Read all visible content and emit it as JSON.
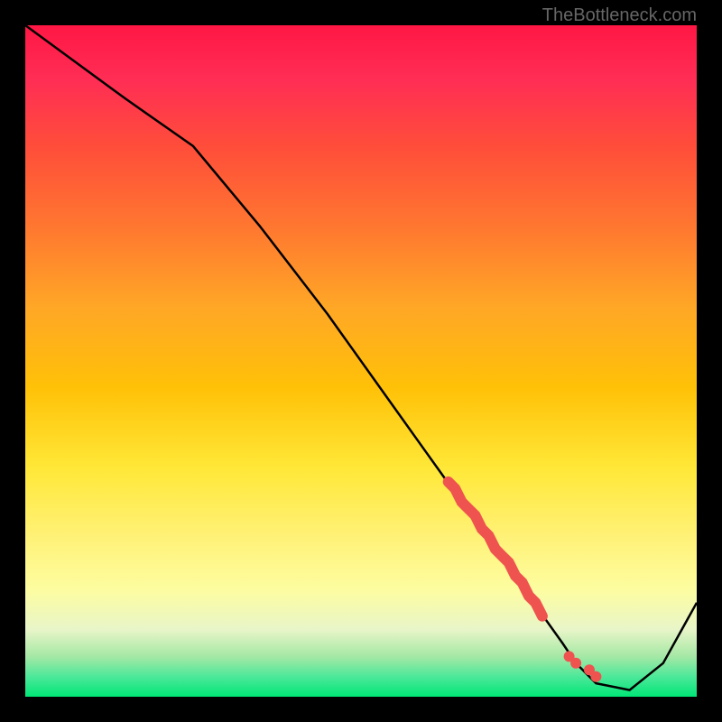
{
  "watermark": "TheBottleneck.com",
  "chart_data": {
    "type": "line",
    "title": "",
    "xlabel": "",
    "ylabel": "",
    "xlim": [
      0,
      100
    ],
    "ylim": [
      0,
      100
    ],
    "series": [
      {
        "name": "bottleneck-curve",
        "x": [
          0,
          15,
          25,
          35,
          45,
          55,
          60,
          65,
          70,
          75,
          80,
          82,
          85,
          90,
          95,
          100
        ],
        "values": [
          100,
          89,
          82,
          70,
          57,
          43,
          36,
          29,
          22,
          15,
          8,
          5,
          2,
          1,
          5,
          14
        ]
      }
    ],
    "markers": {
      "name": "highlight-segment",
      "color": "#ef5350",
      "points": [
        {
          "x": 63,
          "y": 32
        },
        {
          "x": 64,
          "y": 31
        },
        {
          "x": 65,
          "y": 29
        },
        {
          "x": 66,
          "y": 28
        },
        {
          "x": 67,
          "y": 27
        },
        {
          "x": 68,
          "y": 25
        },
        {
          "x": 69,
          "y": 24
        },
        {
          "x": 70,
          "y": 22
        },
        {
          "x": 71,
          "y": 21
        },
        {
          "x": 72,
          "y": 20
        },
        {
          "x": 73,
          "y": 18
        },
        {
          "x": 74,
          "y": 17
        },
        {
          "x": 75,
          "y": 15
        },
        {
          "x": 76,
          "y": 14
        },
        {
          "x": 77,
          "y": 12
        }
      ],
      "extra_points": [
        {
          "x": 81,
          "y": 6
        },
        {
          "x": 82,
          "y": 5
        },
        {
          "x": 84,
          "y": 4
        },
        {
          "x": 85,
          "y": 3
        }
      ]
    }
  }
}
